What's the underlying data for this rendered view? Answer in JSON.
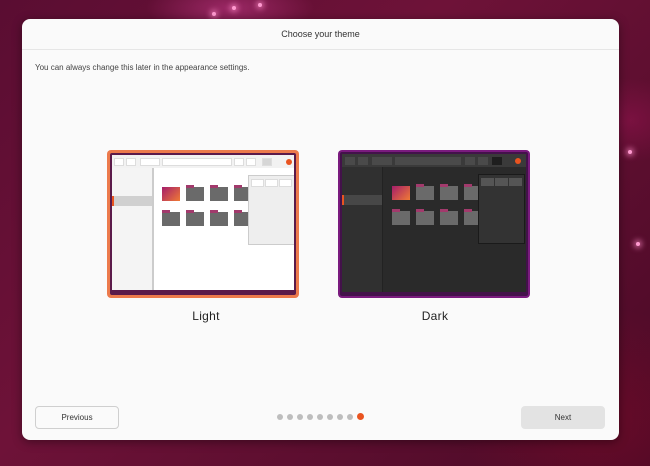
{
  "dialog": {
    "title": "Choose your theme",
    "subtitle": "You can always change this later in the appearance settings."
  },
  "themes": [
    {
      "id": "light",
      "label": "Light",
      "selected": true
    },
    {
      "id": "dark",
      "label": "Dark",
      "selected": false
    }
  ],
  "navigation": {
    "previous_label": "Previous",
    "next_label": "Next"
  },
  "pager": {
    "total_steps": 9,
    "current_step": 9
  },
  "colors": {
    "accent": "#e95420",
    "light_selected_border": "#ec7a4c",
    "dark_border": "#7a1b7e"
  }
}
